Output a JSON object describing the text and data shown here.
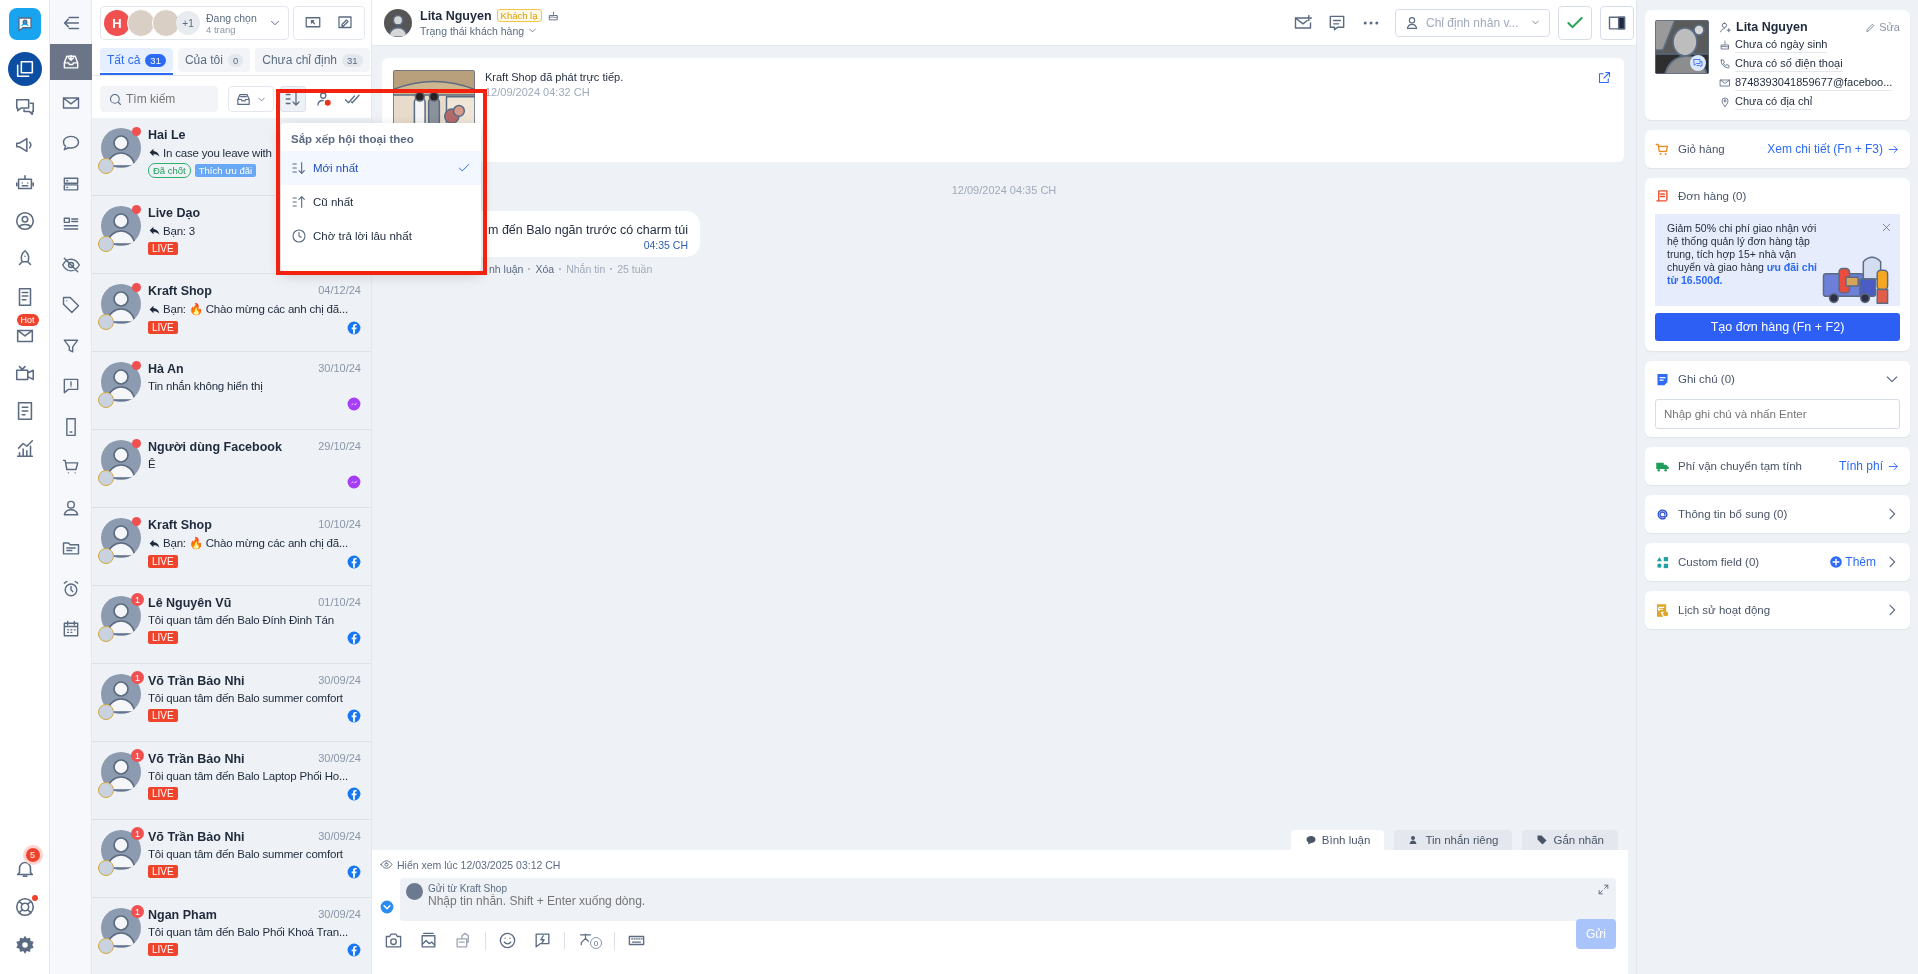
{
  "app_rail": {
    "items": [
      {
        "selected": true
      },
      {
        "selected": false
      },
      {
        "selected": false
      },
      {
        "selected": false
      },
      {
        "selected": false
      },
      {
        "selected": false
      },
      {
        "selected": false
      },
      {
        "selected": false,
        "badge": "Hot"
      },
      {
        "selected": false
      },
      {
        "selected": false
      },
      {
        "selected": false
      }
    ],
    "notifications": {
      "badge": "5"
    },
    "help": {
      "dot": true
    }
  },
  "nav_column": {
    "items": [
      {
        "selected": true
      },
      {
        "selected": false
      },
      {
        "selected": false
      },
      {
        "selected": false
      },
      {
        "selected": false
      },
      {
        "selected": false
      },
      {
        "selected": false
      },
      {
        "selected": false
      },
      {
        "selected": false
      },
      {
        "selected": false
      },
      {
        "selected": false
      },
      {
        "selected": false
      },
      {
        "selected": false
      },
      {
        "selected": false
      },
      {
        "selected": false
      }
    ]
  },
  "page_picker": {
    "initial": "H",
    "extra_count": "+1",
    "label": "Đang chọn",
    "sublabel": "4 trang"
  },
  "list_tabs": [
    {
      "label": "Tất cả",
      "count": "31",
      "selected": true
    },
    {
      "label": "Của tôi",
      "count": "0",
      "selected": false
    },
    {
      "label": "Chưa chỉ định",
      "count": "31",
      "selected": false
    }
  ],
  "search": {
    "placeholder": "Tìm kiếm"
  },
  "sort_toolbar": {
    "sort_active": true,
    "assign_dot": true
  },
  "sort_menu": {
    "title": "Sắp xếp hội thoại theo",
    "options": [
      {
        "label": "Mới nhất",
        "kind": "newest",
        "selected": true
      },
      {
        "label": "Cũ nhất",
        "kind": "oldest",
        "selected": false
      },
      {
        "label": "Chờ trả lời lâu nhất",
        "kind": "waiting",
        "selected": false
      }
    ]
  },
  "conversations": [
    {
      "name": "Hai Le",
      "replied": true,
      "preview": "In case you leave with",
      "tags": [
        {
          "label": "Đã chốt",
          "kind": "outline"
        },
        {
          "label": "Thích ưu đãi",
          "kind": "filled"
        }
      ],
      "new_dot": true
    },
    {
      "name": "Live Dạo",
      "replied": true,
      "preview": "Bạn: 3",
      "badge": "LIVE",
      "new_dot": true
    },
    {
      "name": "Kraft Shop",
      "date": "04/12/24",
      "replied": true,
      "preview": "Bạn: 🔥 Chào mừng các anh chị đã...",
      "badge": "LIVE",
      "kind": "facebook",
      "new_dot": true
    },
    {
      "name": "Hà An",
      "date": "30/10/24",
      "replied": false,
      "preview": "Tin nhắn không hiển thị",
      "kind": "messenger",
      "new_dot": true
    },
    {
      "name": "Người dùng Facebook",
      "date": "29/10/24",
      "replied": false,
      "preview": "Ê",
      "kind": "messenger",
      "new_dot": true
    },
    {
      "name": "Kraft Shop",
      "date": "10/10/24",
      "replied": true,
      "preview": "Bạn: 🔥 Chào mừng các anh chị đã...",
      "badge": "LIVE",
      "kind": "facebook",
      "new_dot": true
    },
    {
      "name": "Lê Nguyên Vũ",
      "date": "01/10/24",
      "replied": false,
      "preview": "Tôi quan tâm đến Balo Đính Đinh Tán",
      "badge": "LIVE",
      "kind": "facebook",
      "unread_count": "1"
    },
    {
      "name": "Võ Trần Bảo Nhi",
      "date": "30/09/24",
      "replied": false,
      "preview": "Tôi quan tâm đến Balo summer comfort",
      "badge": "LIVE",
      "kind": "facebook",
      "unread_count": "1"
    },
    {
      "name": "Võ Trần Bảo Nhi",
      "date": "30/09/24",
      "replied": false,
      "preview": "Tôi quan tâm đến Balo Laptop Phối Ho...",
      "badge": "LIVE",
      "kind": "facebook",
      "unread_count": "1"
    },
    {
      "name": "Võ Trần Bảo Nhi",
      "date": "30/09/24",
      "replied": false,
      "preview": "Tôi quan tâm đến Balo summer comfort",
      "badge": "LIVE",
      "kind": "facebook",
      "unread_count": "1"
    },
    {
      "name": "Ngan Pham",
      "date": "30/09/24",
      "replied": false,
      "preview": "Tôi quan tâm đến Balo Phối Khoá Tran...",
      "badge": "LIVE",
      "kind": "facebook",
      "unread_count": "1"
    }
  ],
  "chat_header": {
    "name": "Lita Nguyen",
    "badge": "Khách lạ",
    "status_label": "Trạng thái khách hàng",
    "assign_placeholder": "Chỉ định nhân v..."
  },
  "live_card": {
    "text": "Kraft Shop đã phát trực tiếp.",
    "time": "12/09/2024 04:32 CH"
  },
  "date_divider": "12/09/2024 04:35 CH",
  "message": {
    "text": "m đến Balo ngăn trước có charm túi",
    "time": "04:35 CH",
    "actions": [
      "nh luận",
      "Xóa"
    ],
    "meta": [
      "Nhắn tin",
      "25 tuần"
    ]
  },
  "composer": {
    "tabs": [
      {
        "label": "Bình luận",
        "selected": true
      },
      {
        "label": "Tin nhắn riêng",
        "selected": false
      },
      {
        "label": "Gắn nhãn",
        "selected": false
      }
    ],
    "seen": "Hiển xem lúc 12/03/2025 03:12 CH",
    "sender": "Gửi từ Kraft Shop",
    "placeholder": "Nhập tin nhắn. Shift + Enter xuống dòng.",
    "flow_count": "0",
    "send": {
      "label": "Gửi",
      "disabled": true
    }
  },
  "profile": {
    "name": "Lita Nguyen",
    "edit": "Sửa",
    "fields": [
      "Chưa có ngày sinh",
      "Chưa có số điện thoại",
      "8748393041859677@faceboo...",
      "Chưa có địa chỉ"
    ]
  },
  "cart": {
    "title": "Giỏ hàng",
    "link": "Xem chi tiết (Fn + F3)"
  },
  "orders": {
    "title": "Đơn hàng (0)",
    "promo": "Giảm 50% chi phí giao nhận với hệ thống quản lý đơn hàng tập trung, tích hợp 15+ nhà vận chuyển và giao hàng **ưu đãi chỉ từ 16.500đ.**",
    "button": "Tạo đơn hàng (Fn + F2)"
  },
  "notes": {
    "title": "Ghi chú (0)",
    "expanded": true,
    "placeholder": "Nhập ghi chú và nhấn Enter"
  },
  "shipping": {
    "title": "Phí vận chuyển tạm tính",
    "link": "Tính phí"
  },
  "extra_info": {
    "title": "Thông tin bổ sung (0)"
  },
  "custom_field": {
    "title": "Custom field (0)",
    "add": "Thêm"
  },
  "history": {
    "title": "Lịch sử hoạt động"
  }
}
